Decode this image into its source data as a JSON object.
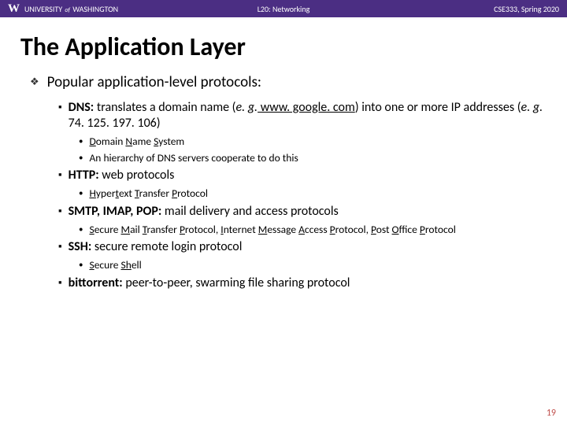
{
  "header": {
    "university_prefix": "UNIVERSITY",
    "university_of": "of",
    "university_name": "WASHINGTON",
    "lecture": "L20:  Networking",
    "course": "CSE333, Spring 2020"
  },
  "title": "The Application Layer",
  "lvl1_text": "Popular application-level protocols:",
  "dns": {
    "label": "DNS:",
    "text1": "  translates a domain name (",
    "eg1": "e. g.",
    "link": " www. google. com",
    "text2": ") into one or more IP addresses (",
    "eg2": "e. g.",
    "text3": " 74. 125. 197. 106)"
  },
  "dns_sub1": {
    "pre": "",
    "u1": "D",
    "mid1": "omain ",
    "u2": "N",
    "mid2": "ame ",
    "u3": "S",
    "post": "ystem"
  },
  "dns_sub2": "An hierarchy of DNS servers cooperate to do this",
  "http": {
    "label": "HTTP:",
    "text": "  web protocols"
  },
  "http_sub": {
    "u1": "H",
    "t1": "yper",
    "u2": "t",
    "t2": "ext ",
    "u3": "T",
    "t3": "ransfer ",
    "u4": "P",
    "t4": "rotocol"
  },
  "smtp": {
    "label": "SMTP, IMAP, POP:",
    "text": "  mail delivery and access protocols"
  },
  "smtp_sub": {
    "u1": "S",
    "t1": "ecure ",
    "u2": "M",
    "t2": "ail ",
    "u3": "T",
    "t3": "ransfer ",
    "u4": "P",
    "t4": "rotocol, ",
    "u5": "I",
    "t5": "nternet ",
    "u6": "M",
    "t6": "essage ",
    "u7": "A",
    "t7": "ccess ",
    "u8": "P",
    "t8": "rotocol, ",
    "u9": "P",
    "t9": "ost ",
    "u10": "O",
    "t10": "ffice ",
    "u11": "P",
    "t11": "rotocol"
  },
  "ssh": {
    "label": "SSH:",
    "text": "  secure remote login protocol"
  },
  "ssh_sub": {
    "u1": "S",
    "t1": "ecure ",
    "u2": "Sh",
    "t2": "ell"
  },
  "bt": {
    "label": "bittorrent:",
    "text": "  peer-to-peer, swarming file sharing protocol"
  },
  "page_number": "19"
}
